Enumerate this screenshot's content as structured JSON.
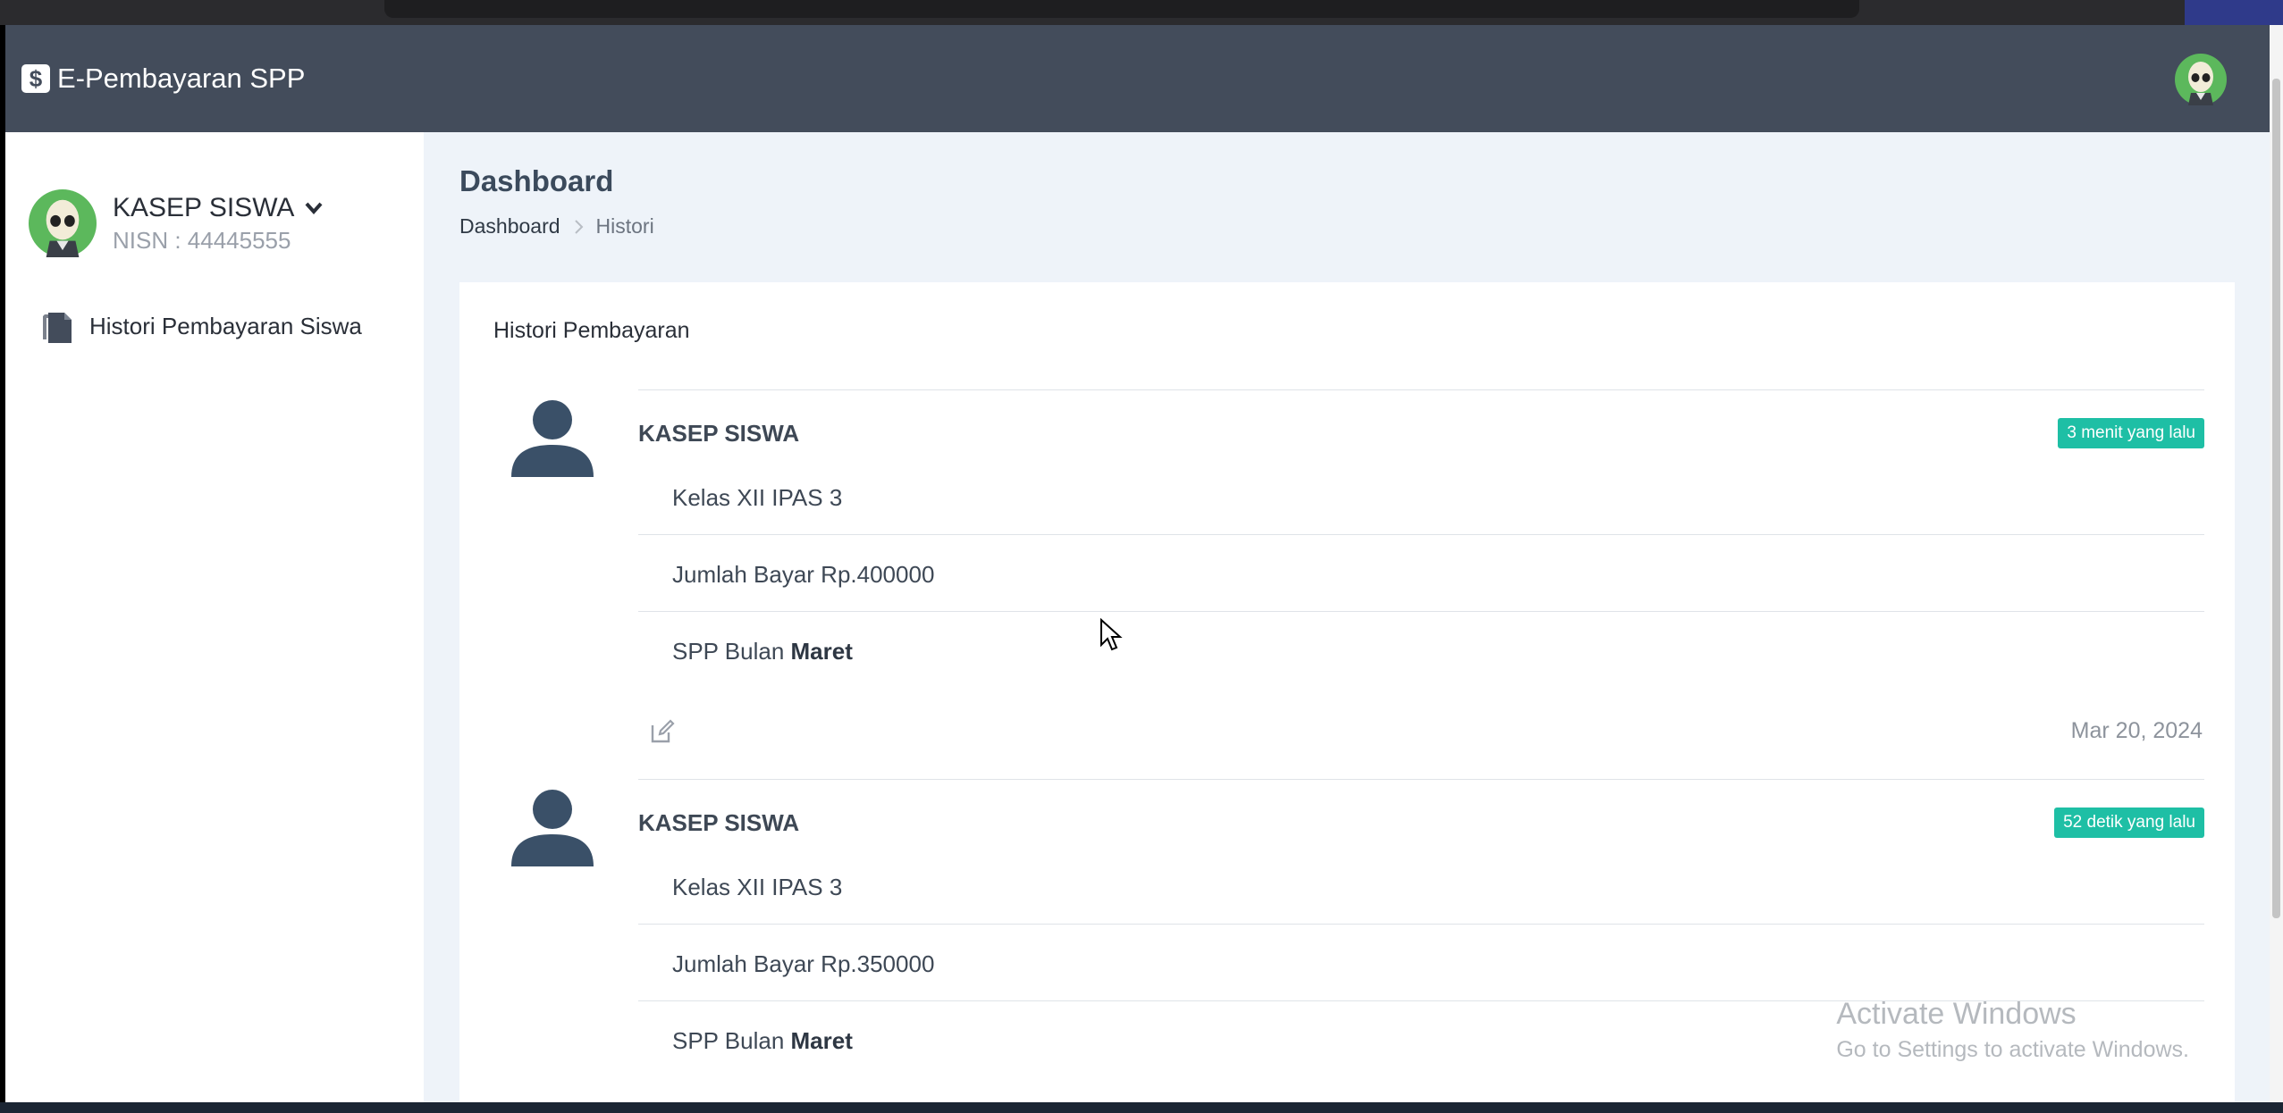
{
  "app": {
    "brand_icon": "$",
    "brand_title": "E-Pembayaran SPP"
  },
  "sidebar": {
    "user_name": "KASEP SISWA",
    "user_nisn": "NISN : 44445555",
    "nav_item_label": "Histori Pembayaran Siswa"
  },
  "page": {
    "title": "Dashboard",
    "breadcrumb_home": "Dashboard",
    "breadcrumb_sep": ">",
    "breadcrumb_current": "Histori"
  },
  "card": {
    "title": "Histori Pembayaran",
    "entries": [
      {
        "name": "KASEP SISWA",
        "badge": "3 menit yang lalu",
        "kelas": "Kelas XII IPAS 3",
        "jumlah": "Jumlah Bayar Rp.400000",
        "bulan_prefix": "SPP Bulan ",
        "bulan": "Maret",
        "date": "Mar 20, 2024"
      },
      {
        "name": "KASEP SISWA",
        "badge": "52 detik yang lalu",
        "kelas": "Kelas XII IPAS 3",
        "jumlah": "Jumlah Bayar Rp.350000",
        "bulan_prefix": "SPP Bulan ",
        "bulan": "Maret"
      }
    ]
  },
  "watermark": {
    "line1": "Activate Windows",
    "line2": "Go to Settings to activate Windows."
  },
  "colors": {
    "topbar": "#434c5b",
    "badge": "#1ebfa5",
    "background": "#eef3f9"
  },
  "icons": {
    "brand": "dollar-icon",
    "avatar": "alien-avatar-icon",
    "nav": "document-icon",
    "entry_avatar": "user-icon",
    "edit": "edit-icon",
    "dropdown": "chevron-down-icon"
  }
}
